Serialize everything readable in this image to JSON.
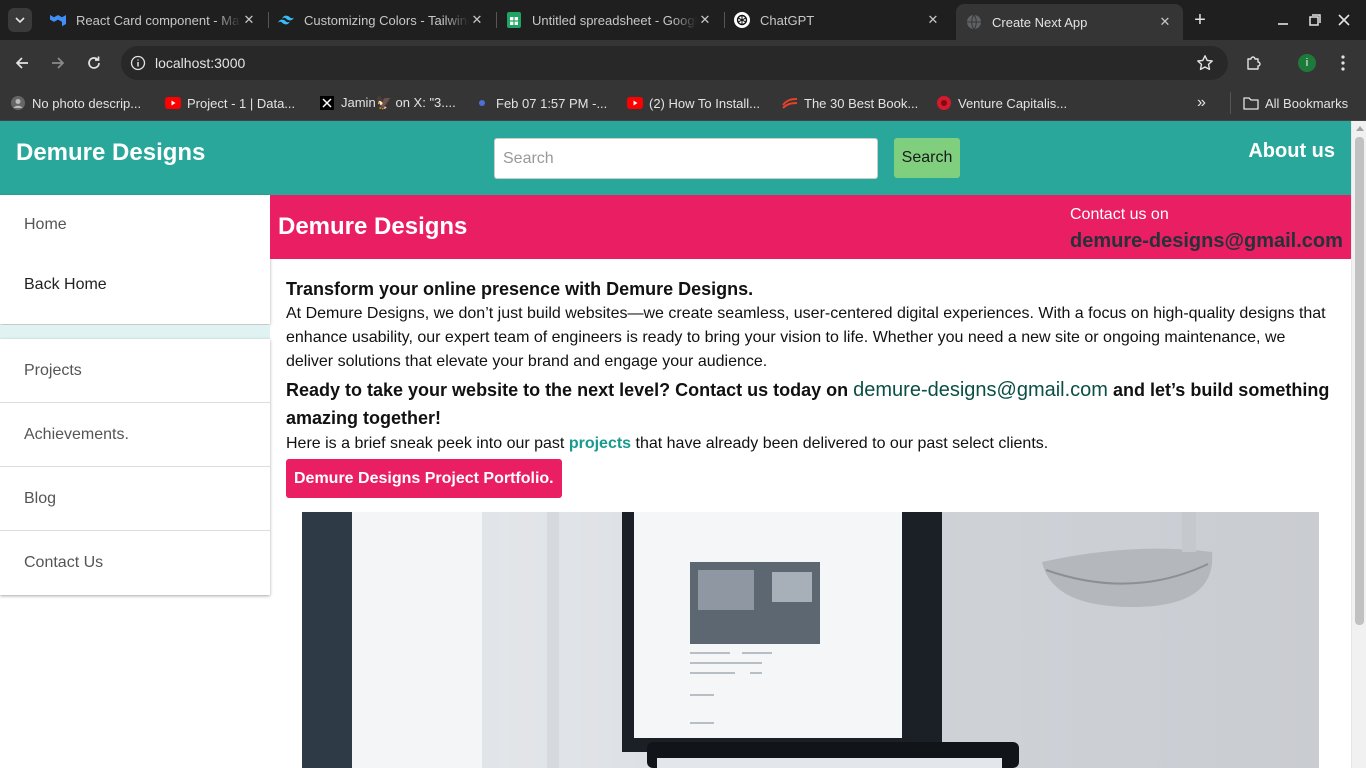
{
  "browser": {
    "tabs": [
      {
        "title": "React Card component - Mater",
        "icon": "mui-icon"
      },
      {
        "title": "Customizing Colors - Tailwind",
        "icon": "tailwind-icon"
      },
      {
        "title": "Untitled spreadsheet - Google",
        "icon": "sheets-icon"
      },
      {
        "title": "ChatGPT",
        "icon": "chatgpt-icon"
      },
      {
        "title": "Create Next App",
        "icon": "globe-icon",
        "active": true
      }
    ],
    "url": "localhost:3000",
    "profile_initial": "i",
    "bookmarks": [
      {
        "title": "No photo descrip...",
        "icon": "image-icon"
      },
      {
        "title": "Project - 1 | Data...",
        "icon": "youtube-icon"
      },
      {
        "title": "Jamin🦅 on X: \"3....",
        "icon": "x-icon"
      },
      {
        "title": "Feb 07 1:57 PM -...",
        "icon": "dot-icon"
      },
      {
        "title": "(2) How To Install...",
        "icon": "youtube-icon"
      },
      {
        "title": "The 30 Best Book...",
        "icon": "book-icon"
      },
      {
        "title": "Venture Capitalis...",
        "icon": "vc-icon"
      }
    ],
    "all_bookmarks": "All Bookmarks"
  },
  "header": {
    "brand": "Demure Designs",
    "search_placeholder": "Search",
    "search_button": "Search",
    "about": "About us"
  },
  "sidebar": {
    "top_items": [
      "Home",
      "Back Home"
    ],
    "items": [
      "Projects",
      "Achievements.",
      "Blog",
      "Contact Us"
    ]
  },
  "banner": {
    "title": "Demure Designs",
    "contact_label": "Contact us on",
    "contact_email": "demure-designs@gmail.com"
  },
  "content": {
    "heading": "Transform your online presence with Demure Designs.",
    "paragraph": "At Demure Designs, we don’t just build websites—we create seamless, user-centered digital experiences. With a focus on high-quality designs that enhance usability, our expert team of engineers is ready to bring your vision to life. Whether you need a new site or ongoing maintenance, we deliver solutions that elevate your brand and engage your audience.",
    "cta_before": "Ready to take your website to the next level? Contact us today on ",
    "cta_email": "demure-designs@gmail.com",
    "cta_after": " and let’s build something amazing together!",
    "peek_before": "Here is a brief sneak peek into our past ",
    "peek_link": "projects",
    "peek_after": " that have already been delivered to our past select clients.",
    "portfolio_button": "Demure Designs Project Portfolio."
  },
  "colors": {
    "header": "#2aa79b",
    "banner": "#e91e63",
    "search_button": "#7fcf7f"
  }
}
